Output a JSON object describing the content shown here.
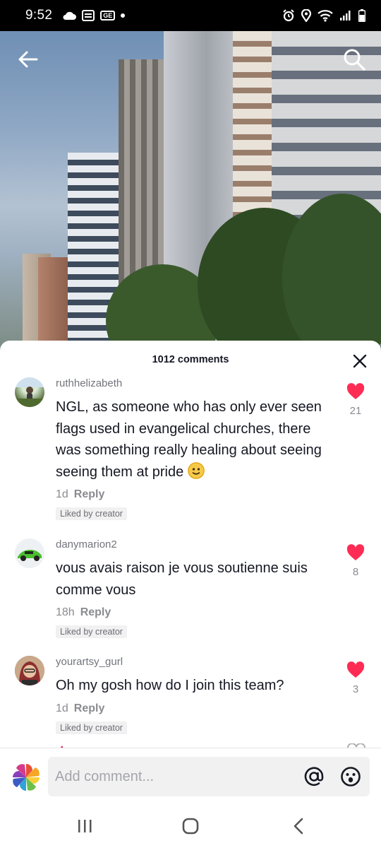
{
  "status_bar": {
    "time": "9:52",
    "left_icons": [
      "cloud-icon",
      "message-icon",
      "ge-app-icon",
      "dot-icon"
    ],
    "right_icons": [
      "alarm-icon",
      "location-icon",
      "wifi-icon",
      "signal-icon",
      "battery-icon"
    ],
    "ge_label": "GE"
  },
  "video": {
    "back_icon": "back-arrow-icon",
    "search_icon": "search-icon"
  },
  "comments_sheet": {
    "count_label": "1012 comments",
    "close_icon": "close-icon",
    "comments": [
      {
        "username": "ruthhelizabeth",
        "text": "NGL, as someone who has only ever seen flags used in evangelical churches, there was something really healing about seeing seeing them at pride",
        "emoji": "slightly-smiling-face",
        "time": "1d",
        "reply_label": "Reply",
        "badge": "Liked by creator",
        "likes": "21"
      },
      {
        "username": "danymarion2",
        "text": "vous avais raison je vous soutienne suis comme vous",
        "time": "18h",
        "reply_label": "Reply",
        "badge": "Liked by creator",
        "likes": "8"
      },
      {
        "username": "yourartsy_gurl",
        "text": "Oh my gosh how do I join this team?",
        "time": "1d",
        "reply_label": "Reply",
        "badge": "Liked by creator",
        "likes": "3"
      }
    ]
  },
  "input": {
    "placeholder": "Add comment...",
    "mention_icon": "at-icon",
    "emoji_icon": "emoji-icon"
  },
  "nav": {
    "recents_icon": "recents-icon",
    "home_icon": "home-icon",
    "back_icon": "nav-back-icon"
  },
  "colors": {
    "like_red": "#fe2c55",
    "text_primary": "#161823",
    "text_secondary": "#8a8b91"
  }
}
